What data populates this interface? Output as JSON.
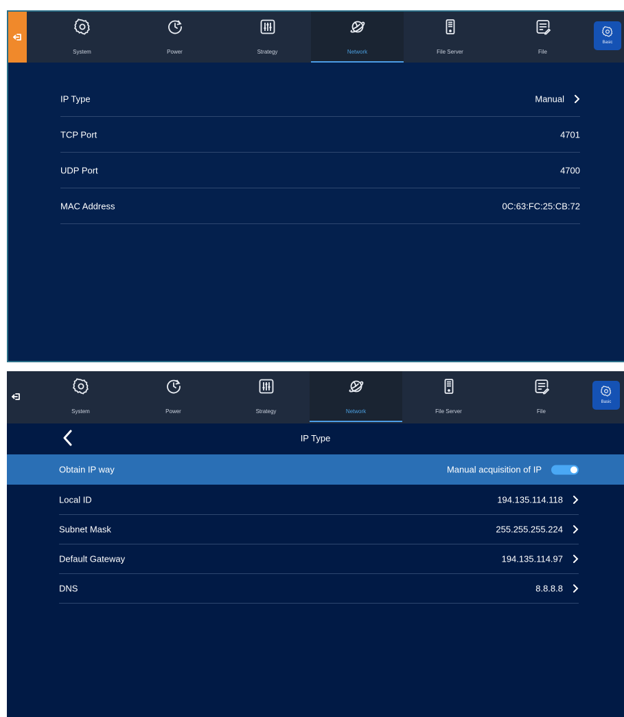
{
  "tabs": [
    {
      "id": "system",
      "label": "System",
      "icon": "gear-icon"
    },
    {
      "id": "power",
      "label": "Power",
      "icon": "power-timer-icon"
    },
    {
      "id": "strategy",
      "label": "Strategy",
      "icon": "sliders-icon"
    },
    {
      "id": "network",
      "label": "Network",
      "icon": "globe-icon"
    },
    {
      "id": "file_server",
      "label": "File Server",
      "icon": "server-icon"
    },
    {
      "id": "file",
      "label": "File",
      "icon": "document-icon"
    }
  ],
  "active_tab": "Network",
  "basic_label": "Basic",
  "network_settings": {
    "ip_type": {
      "label": "IP Type",
      "value": "Manual"
    },
    "tcp_port": {
      "label": "TCP Port",
      "value": "4701"
    },
    "udp_port": {
      "label": "UDP Port",
      "value": "4700"
    },
    "mac_address": {
      "label": "MAC Address",
      "value": "0C:63:FC:25:CB:72"
    }
  },
  "ip_type_page": {
    "title": "IP Type",
    "obtain_ip": {
      "label": "Obtain IP way",
      "value": "Manual acquisition of IP",
      "toggle_on": true
    },
    "local_id": {
      "label": "Local ID",
      "value": "194.135.114.118"
    },
    "subnet_mask": {
      "label": "Subnet Mask",
      "value": "255.255.255.224"
    },
    "default_gateway": {
      "label": "Default Gateway",
      "value": "194.135.114.97"
    },
    "dns": {
      "label": "DNS",
      "value": "8.8.8.8"
    }
  },
  "colors": {
    "accent_orange": "#f0892b",
    "background": "#04204d",
    "highlight": "#2a6fb5",
    "active_tab": "#4b9fe0"
  }
}
